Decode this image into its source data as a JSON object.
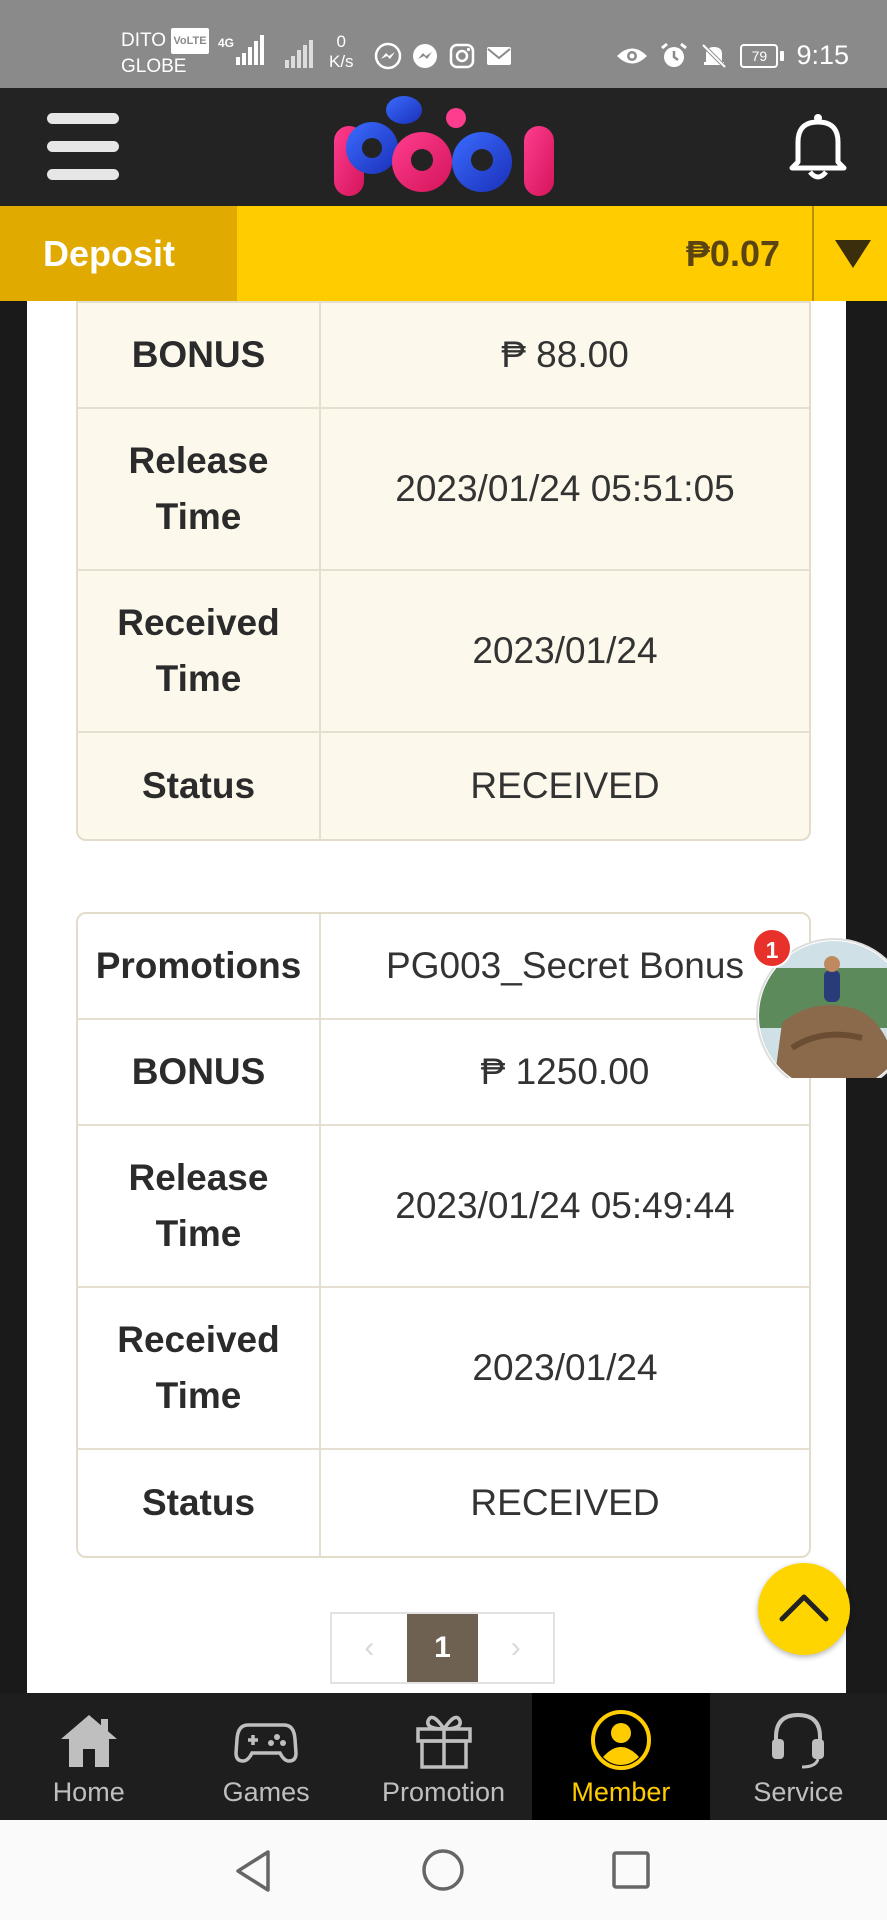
{
  "status_bar": {
    "carrier_line1": "DITO",
    "volte": "VoLTE",
    "carrier_line2": "GLOBE",
    "network_type": "4G",
    "speed_value": "0",
    "speed_unit": "K/s",
    "battery": "79",
    "time": "9:15"
  },
  "header": {
    "logo_alt": "PGG1",
    "deposit_label": "Deposit",
    "balance": "₱0.07"
  },
  "records": [
    {
      "rows": [
        {
          "label": "",
          "value": ""
        },
        {
          "label": "BONUS",
          "value": "₱ 88.00"
        },
        {
          "label": "Release Time",
          "value": "2023/01/24 05:51:05"
        },
        {
          "label": "Received Time",
          "value": "2023/01/24"
        },
        {
          "label": "Status",
          "value": "RECEIVED"
        }
      ]
    },
    {
      "rows": [
        {
          "label": "Promotions",
          "value": "PG003_Secret Bonus"
        },
        {
          "label": "BONUS",
          "value": "₱ 1250.00"
        },
        {
          "label": "Release Time",
          "value": "2023/01/24 05:49:44"
        },
        {
          "label": "Received Time",
          "value": "2023/01/24"
        },
        {
          "label": "Status",
          "value": "RECEIVED"
        }
      ]
    }
  ],
  "pagination": {
    "prev": "‹",
    "current": "1",
    "next": "›"
  },
  "chat": {
    "badge_count": "1"
  },
  "bottom_nav": [
    {
      "label": "Home",
      "icon": "home-icon",
      "active": false
    },
    {
      "label": "Games",
      "icon": "gamepad-icon",
      "active": false
    },
    {
      "label": "Promotion",
      "icon": "gift-icon",
      "active": false
    },
    {
      "label": "Member",
      "icon": "member-icon",
      "active": true
    },
    {
      "label": "Service",
      "icon": "headset-icon",
      "active": false
    }
  ],
  "colors": {
    "accent": "#ffcc00",
    "deposit_button": "#e0aa00",
    "header_bg": "#232323",
    "card1_bg": "#fcf8ec",
    "pager_active": "#6e6152",
    "badge": "#e8312a"
  }
}
